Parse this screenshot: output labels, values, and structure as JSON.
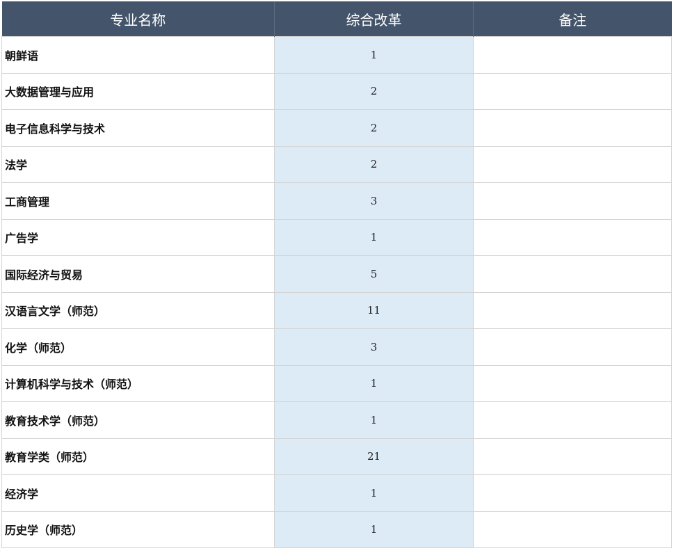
{
  "table": {
    "headers": [
      "专业名称",
      "综合改革",
      "备注"
    ],
    "rows": [
      {
        "name": "朝鲜语",
        "count": "1",
        "note": ""
      },
      {
        "name": "大数据管理与应用",
        "count": "2",
        "note": ""
      },
      {
        "name": "电子信息科学与技术",
        "count": "2",
        "note": ""
      },
      {
        "name": "法学",
        "count": "2",
        "note": ""
      },
      {
        "name": "工商管理",
        "count": "3",
        "note": ""
      },
      {
        "name": "广告学",
        "count": "1",
        "note": ""
      },
      {
        "name": "国际经济与贸易",
        "count": "5",
        "note": ""
      },
      {
        "name": "汉语言文学（师范）",
        "count": "11",
        "note": ""
      },
      {
        "name": "化学（师范）",
        "count": "3",
        "note": ""
      },
      {
        "name": "计算机科学与技术（师范）",
        "count": "1",
        "note": ""
      },
      {
        "name": "教育技术学（师范）",
        "count": "1",
        "note": ""
      },
      {
        "name": "教育学类（师范）",
        "count": "21",
        "note": ""
      },
      {
        "name": "经济学",
        "count": "1",
        "note": ""
      },
      {
        "name": "历史学（师范）",
        "count": "1",
        "note": ""
      }
    ]
  },
  "colors": {
    "header_bg": "#44546a",
    "header_text": "#ffffff",
    "count_col_bg": "#ddebf7",
    "grid": "#d4d4d4"
  }
}
